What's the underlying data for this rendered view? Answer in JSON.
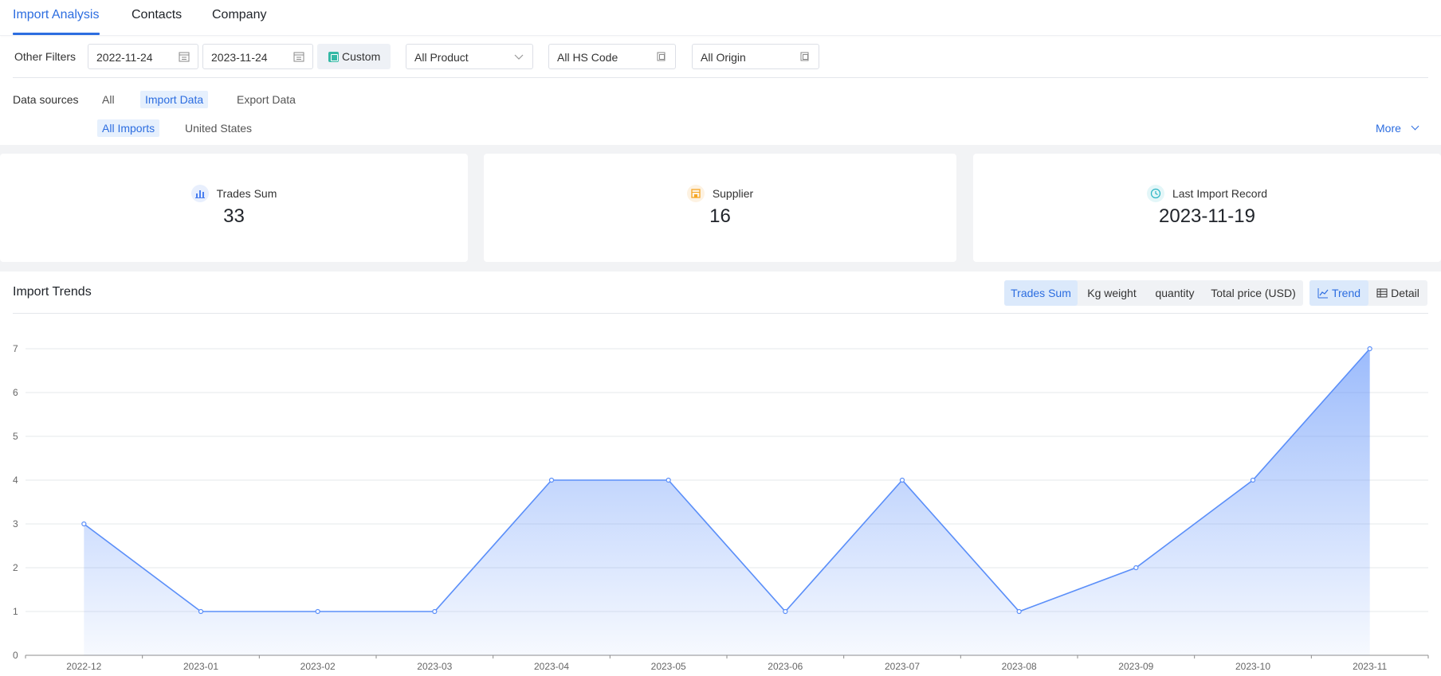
{
  "tabs": [
    {
      "label": "Import Analysis",
      "active": true
    },
    {
      "label": "Contacts",
      "active": false
    },
    {
      "label": "Company",
      "active": false
    }
  ],
  "filters": {
    "label": "Other Filters",
    "date_from": "2022-11-24",
    "date_to": "2023-11-24",
    "custom_label": "Custom",
    "product": "All Product",
    "hs_code": "All HS Code",
    "origin": "All Origin"
  },
  "data_sources": {
    "label": "Data sources",
    "options": [
      "All",
      "Import Data",
      "Export Data"
    ],
    "selected": "Import Data",
    "sub_options": [
      "All Imports",
      "United States"
    ],
    "sub_selected": "All Imports",
    "more_label": "More"
  },
  "stats": [
    {
      "label": "Trades Sum",
      "value": "33",
      "icon": "bar-chart-icon",
      "icon_color": "#4a7ff0",
      "icon_bg": "#e8effd"
    },
    {
      "label": "Supplier",
      "value": "16",
      "icon": "store-icon",
      "icon_color": "#f5a623",
      "icon_bg": "#fdf2e2"
    },
    {
      "label": "Last Import Record",
      "value": "2023-11-19",
      "icon": "clock-icon",
      "icon_color": "#2bb5c4",
      "icon_bg": "#e3f6f8"
    }
  ],
  "trends": {
    "title": "Import Trends",
    "metrics": [
      "Trades Sum",
      "Kg weight",
      "quantity",
      "Total price (USD)"
    ],
    "selected_metric": "Trades Sum",
    "views": [
      "Trend",
      "Detail"
    ],
    "selected_view": "Trend"
  },
  "chart_data": {
    "type": "area",
    "categories": [
      "2022-12",
      "2023-01",
      "2023-02",
      "2023-03",
      "2023-04",
      "2023-05",
      "2023-06",
      "2023-07",
      "2023-08",
      "2023-09",
      "2023-10",
      "2023-11"
    ],
    "values": [
      3,
      1,
      1,
      1,
      4,
      4,
      1,
      4,
      1,
      2,
      4,
      7
    ],
    "ylim": [
      0,
      7
    ],
    "yticks": [
      0,
      1,
      2,
      3,
      4,
      5,
      6,
      7
    ],
    "grid": true,
    "line_color": "#5b8ff9",
    "fill_color": "#5b8ff9"
  }
}
